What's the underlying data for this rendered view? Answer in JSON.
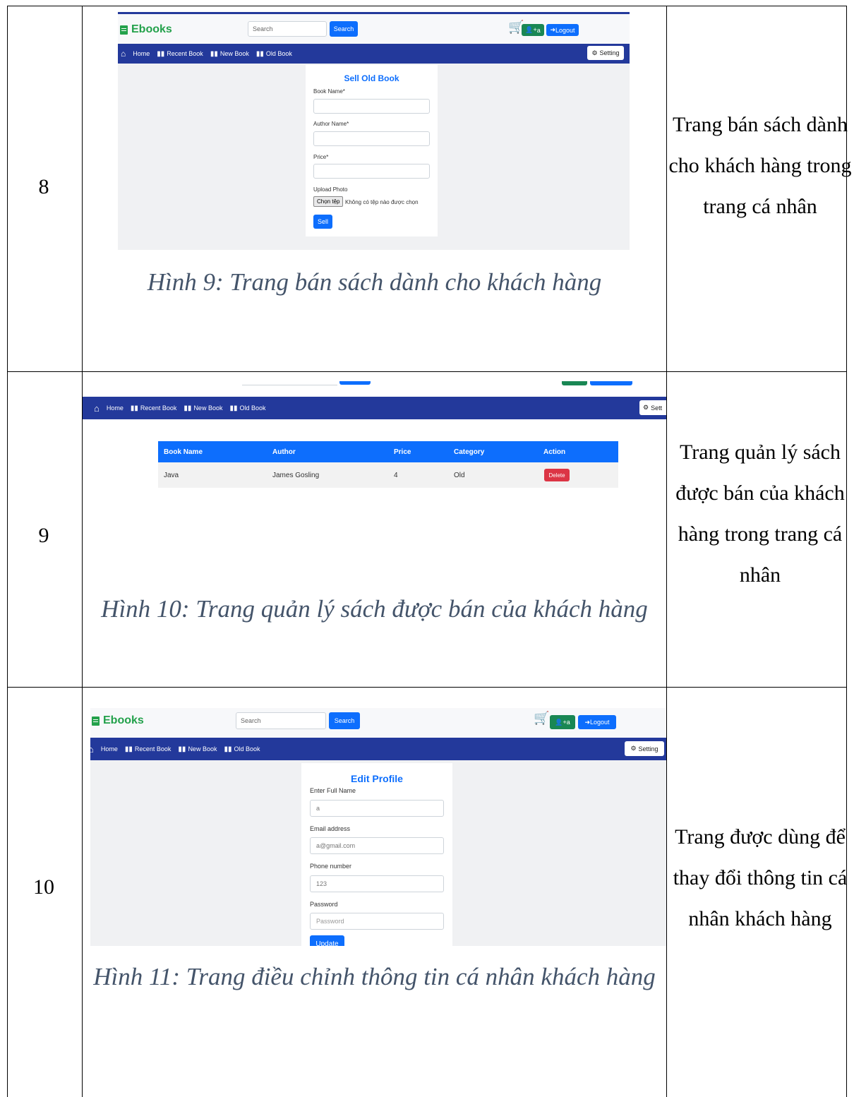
{
  "rows": [
    {
      "number": "8",
      "description": "Trang bán sách dành cho khách hàng trong trang cá nhân",
      "caption": "Hình 9: Trang bán sách dành cho khách hàng"
    },
    {
      "number": "9",
      "description": "Trang quản lý sách được bán của khách hàng trong trang cá nhân",
      "caption": "Hình 10: Trang quản lý sách được bán của khách hàng"
    },
    {
      "number": "10",
      "description": "Trang được dùng để thay đổi thông tin cá nhân khách hàng",
      "caption": "Hình 11: Trang điều chỉnh thông tin cá nhân khách hàng"
    }
  ],
  "app": {
    "brand": "Ebooks",
    "search_placeholder": "Search",
    "search_button": "Search",
    "user_button": "a",
    "logout_button": "Logout",
    "nav": [
      "Home",
      "Recent Book",
      "New Book",
      "Old Book"
    ],
    "setting_button": "Setting",
    "setting_partial": "Sett"
  },
  "sell_form": {
    "title": "Sell Old Book",
    "book_name_label": "Book Name*",
    "author_name_label": "Author Name*",
    "price_label": "Price*",
    "upload_label": "Upload Photo",
    "file_button": "Chọn tệp",
    "file_status": "Không có tệp nào được chọn",
    "submit": "Sell"
  },
  "book_table": {
    "headers": [
      "Book Name",
      "Author",
      "Price",
      "Category",
      "Action"
    ],
    "rows": [
      {
        "book_name": "Java",
        "author": "James Gosling",
        "price": "4",
        "category": "Old",
        "action": "Delete"
      }
    ]
  },
  "profile_form": {
    "title": "Edit Profile",
    "full_name_label": "Enter Full Name",
    "full_name_value": "a",
    "email_label": "Email address",
    "email_value": "a@gmail.com",
    "phone_label": "Phone number",
    "phone_value": "123",
    "password_label": "Password",
    "password_placeholder": "Password",
    "submit": "Update"
  },
  "colors": {
    "navbar": "#23399b",
    "primary": "#0d6efd",
    "brand": "#23a14b",
    "danger": "#dc3545",
    "caption": "#44546a"
  }
}
